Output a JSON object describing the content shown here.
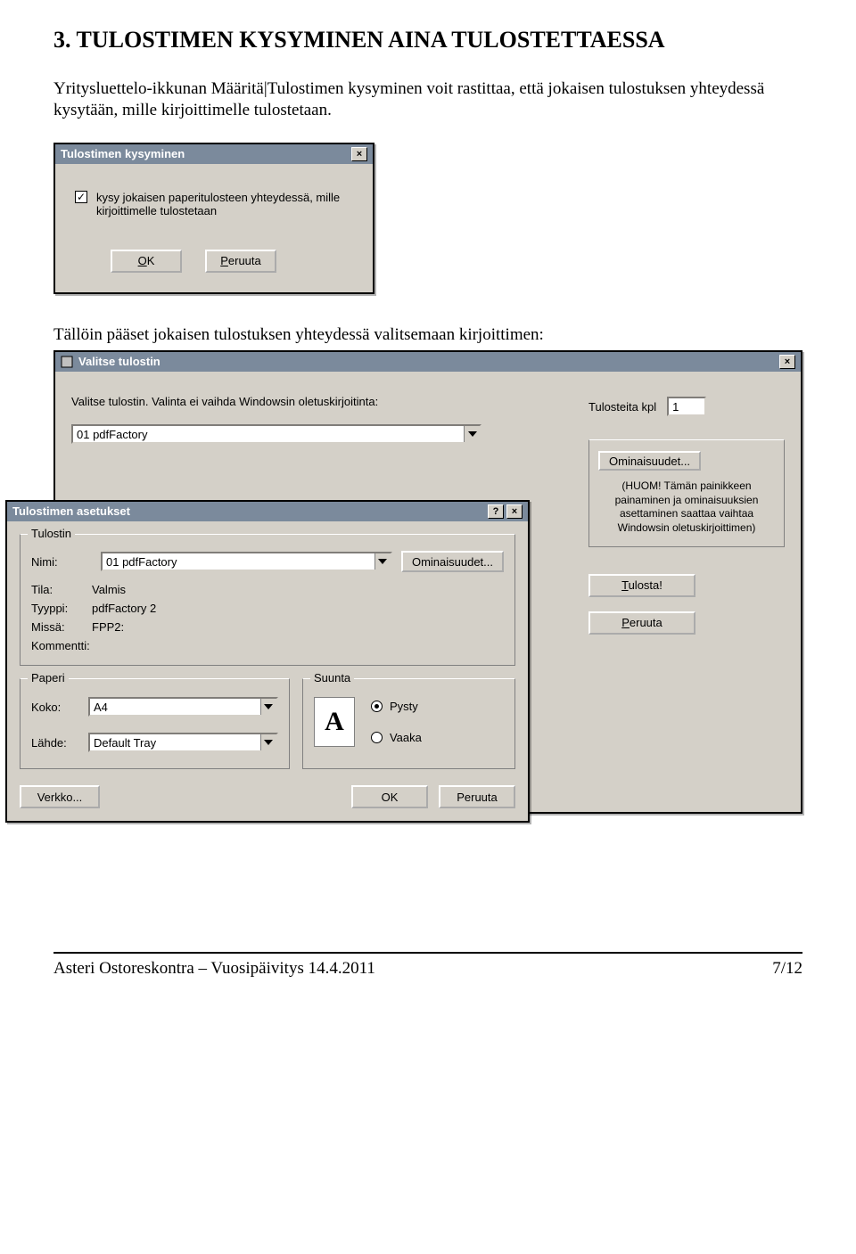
{
  "heading": "3. TULOSTIMEN KYSYMINEN AINA TULOSTETTAESSA",
  "para1": "Yritysluettelo-ikkunan Määritä|Tulostimen kysyminen voit rastittaa, että jokaisen tulostuksen yhteydessä kysytään, mille kirjoittimelle tulostetaan.",
  "para2": "Tällöin pääset jokaisen tulostuksen yhteydessä valitsemaan kirjoittimen:",
  "dlg1": {
    "title": "Tulostimen kysyminen",
    "checkbox_label": "kysy jokaisen paperitulosteen yhteydessä, mille kirjoittimelle tulostetaan",
    "ok": "OK",
    "cancel": "Peruuta"
  },
  "dlg2": {
    "title": "Valitse tulostin",
    "instruction": "Valitse tulostin. Valinta ei vaihda Windowsin oletuskirjoitinta:",
    "selected_printer": "01 pdfFactory",
    "copies_label": "Tulosteita kpl",
    "copies_value": "1",
    "props_label": "Ominaisuudet...",
    "props_note": "(HUOM! Tämän painikkeen painaminen ja ominaisuuksien asettaminen saattaa vaihtaa Windowsin oletuskirjoittimen)",
    "print": "Tulosta!",
    "cancel": "Peruuta"
  },
  "dlg3": {
    "title": "Tulostimen asetukset",
    "grp_printer": "Tulostin",
    "name_label": "Nimi:",
    "name_value": "01 pdfFactory",
    "props_btn": "Ominaisuudet...",
    "status_label": "Tila:",
    "status_value": "Valmis",
    "type_label": "Tyyppi:",
    "type_value": "pdfFactory 2",
    "where_label": "Missä:",
    "where_value": "FPP2:",
    "comment_label": "Kommentti:",
    "comment_value": "",
    "grp_paper": "Paperi",
    "size_label": "Koko:",
    "size_value": "A4",
    "source_label": "Lähde:",
    "source_value": "Default Tray",
    "grp_orient": "Suunta",
    "portrait": "Pysty",
    "landscape": "Vaaka",
    "network": "Verkko...",
    "ok": "OK",
    "cancel": "Peruuta"
  },
  "footer_left": "Asteri Ostoreskontra – Vuosipäivitys 14.4.2011",
  "footer_right": "7/12"
}
